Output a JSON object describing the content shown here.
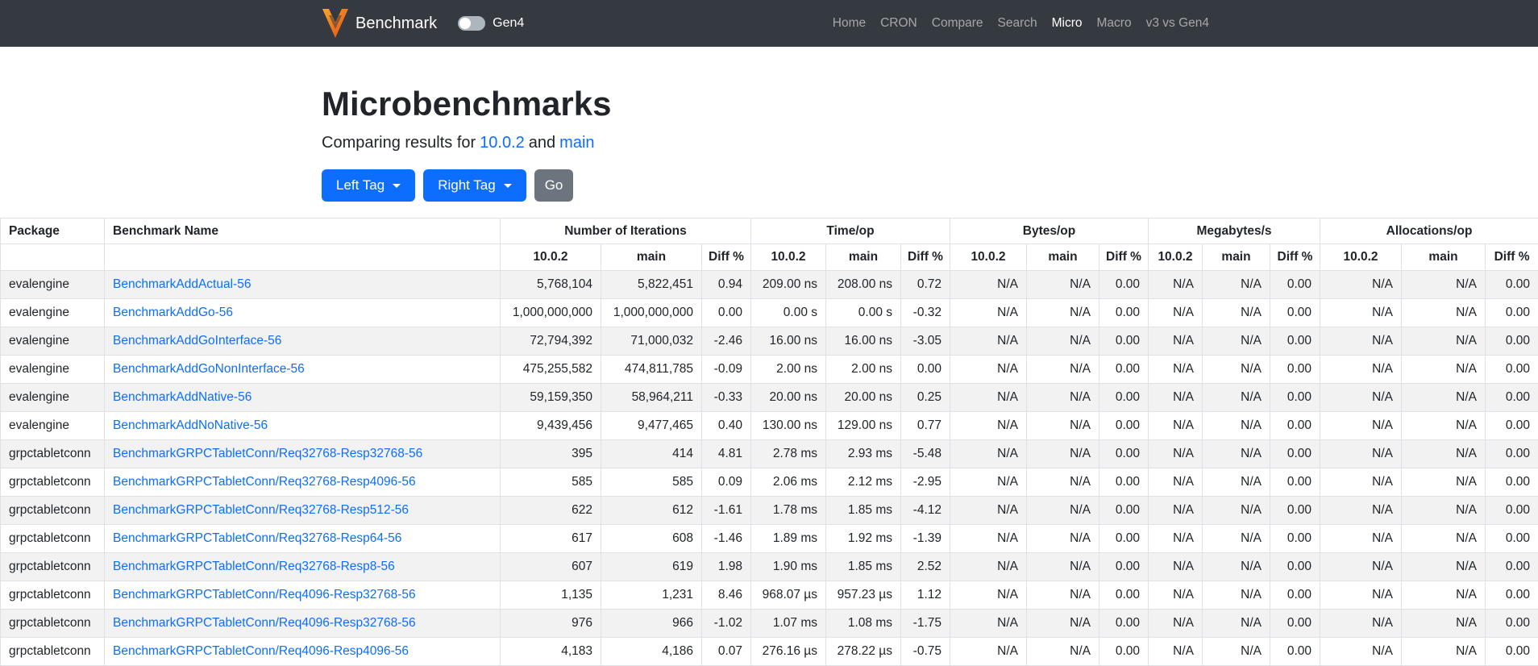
{
  "navbar": {
    "brand": "Benchmark",
    "toggle_label": "Gen4",
    "toggle_state": "off",
    "links": [
      {
        "label": "Home",
        "active": false
      },
      {
        "label": "CRON",
        "active": false
      },
      {
        "label": "Compare",
        "active": false
      },
      {
        "label": "Search",
        "active": false
      },
      {
        "label": "Micro",
        "active": true
      },
      {
        "label": "Macro",
        "active": false
      },
      {
        "label": "v3 vs Gen4",
        "active": false
      }
    ]
  },
  "header": {
    "title": "Microbenchmarks",
    "subtitle_prefix": "Comparing results for",
    "left_tag": "10.0.2",
    "and_word": "and",
    "right_tag": "main"
  },
  "controls": {
    "left_tag_button": "Left Tag",
    "right_tag_button": "Right Tag",
    "go_button": "Go"
  },
  "table": {
    "package_header": "Package",
    "benchmark_header": "Benchmark Name",
    "groups": [
      "Number of Iterations",
      "Time/op",
      "Bytes/op",
      "Megabytes/s",
      "Allocations/op"
    ],
    "sub_headers": [
      "10.0.2",
      "main",
      "Diff %"
    ],
    "rows": [
      {
        "package": "evalengine",
        "name": "BenchmarkAddActual-56",
        "iterations": [
          "5,768,104",
          "5,822,451",
          "0.94"
        ],
        "time": [
          "209.00 ns",
          "208.00 ns",
          "0.72"
        ],
        "bytes": [
          "N/A",
          "N/A",
          "0.00"
        ],
        "megabytes": [
          "N/A",
          "N/A",
          "0.00"
        ],
        "allocations": [
          "N/A",
          "N/A",
          "0.00"
        ]
      },
      {
        "package": "evalengine",
        "name": "BenchmarkAddGo-56",
        "iterations": [
          "1,000,000,000",
          "1,000,000,000",
          "0.00"
        ],
        "time": [
          "0.00 s",
          "0.00 s",
          "-0.32"
        ],
        "bytes": [
          "N/A",
          "N/A",
          "0.00"
        ],
        "megabytes": [
          "N/A",
          "N/A",
          "0.00"
        ],
        "allocations": [
          "N/A",
          "N/A",
          "0.00"
        ]
      },
      {
        "package": "evalengine",
        "name": "BenchmarkAddGoInterface-56",
        "iterations": [
          "72,794,392",
          "71,000,032",
          "-2.46"
        ],
        "time": [
          "16.00 ns",
          "16.00 ns",
          "-3.05"
        ],
        "bytes": [
          "N/A",
          "N/A",
          "0.00"
        ],
        "megabytes": [
          "N/A",
          "N/A",
          "0.00"
        ],
        "allocations": [
          "N/A",
          "N/A",
          "0.00"
        ]
      },
      {
        "package": "evalengine",
        "name": "BenchmarkAddGoNonInterface-56",
        "iterations": [
          "475,255,582",
          "474,811,785",
          "-0.09"
        ],
        "time": [
          "2.00 ns",
          "2.00 ns",
          "0.00"
        ],
        "bytes": [
          "N/A",
          "N/A",
          "0.00"
        ],
        "megabytes": [
          "N/A",
          "N/A",
          "0.00"
        ],
        "allocations": [
          "N/A",
          "N/A",
          "0.00"
        ]
      },
      {
        "package": "evalengine",
        "name": "BenchmarkAddNative-56",
        "iterations": [
          "59,159,350",
          "58,964,211",
          "-0.33"
        ],
        "time": [
          "20.00 ns",
          "20.00 ns",
          "0.25"
        ],
        "bytes": [
          "N/A",
          "N/A",
          "0.00"
        ],
        "megabytes": [
          "N/A",
          "N/A",
          "0.00"
        ],
        "allocations": [
          "N/A",
          "N/A",
          "0.00"
        ]
      },
      {
        "package": "evalengine",
        "name": "BenchmarkAddNoNative-56",
        "iterations": [
          "9,439,456",
          "9,477,465",
          "0.40"
        ],
        "time": [
          "130.00 ns",
          "129.00 ns",
          "0.77"
        ],
        "bytes": [
          "N/A",
          "N/A",
          "0.00"
        ],
        "megabytes": [
          "N/A",
          "N/A",
          "0.00"
        ],
        "allocations": [
          "N/A",
          "N/A",
          "0.00"
        ]
      },
      {
        "package": "grpctabletconn",
        "name": "BenchmarkGRPCTabletConn/Req32768-Resp32768-56",
        "iterations": [
          "395",
          "414",
          "4.81"
        ],
        "time": [
          "2.78 ms",
          "2.93 ms",
          "-5.48"
        ],
        "bytes": [
          "N/A",
          "N/A",
          "0.00"
        ],
        "megabytes": [
          "N/A",
          "N/A",
          "0.00"
        ],
        "allocations": [
          "N/A",
          "N/A",
          "0.00"
        ]
      },
      {
        "package": "grpctabletconn",
        "name": "BenchmarkGRPCTabletConn/Req32768-Resp4096-56",
        "iterations": [
          "585",
          "585",
          "0.09"
        ],
        "time": [
          "2.06 ms",
          "2.12 ms",
          "-2.95"
        ],
        "bytes": [
          "N/A",
          "N/A",
          "0.00"
        ],
        "megabytes": [
          "N/A",
          "N/A",
          "0.00"
        ],
        "allocations": [
          "N/A",
          "N/A",
          "0.00"
        ]
      },
      {
        "package": "grpctabletconn",
        "name": "BenchmarkGRPCTabletConn/Req32768-Resp512-56",
        "iterations": [
          "622",
          "612",
          "-1.61"
        ],
        "time": [
          "1.78 ms",
          "1.85 ms",
          "-4.12"
        ],
        "bytes": [
          "N/A",
          "N/A",
          "0.00"
        ],
        "megabytes": [
          "N/A",
          "N/A",
          "0.00"
        ],
        "allocations": [
          "N/A",
          "N/A",
          "0.00"
        ]
      },
      {
        "package": "grpctabletconn",
        "name": "BenchmarkGRPCTabletConn/Req32768-Resp64-56",
        "iterations": [
          "617",
          "608",
          "-1.46"
        ],
        "time": [
          "1.89 ms",
          "1.92 ms",
          "-1.39"
        ],
        "bytes": [
          "N/A",
          "N/A",
          "0.00"
        ],
        "megabytes": [
          "N/A",
          "N/A",
          "0.00"
        ],
        "allocations": [
          "N/A",
          "N/A",
          "0.00"
        ]
      },
      {
        "package": "grpctabletconn",
        "name": "BenchmarkGRPCTabletConn/Req32768-Resp8-56",
        "iterations": [
          "607",
          "619",
          "1.98"
        ],
        "time": [
          "1.90 ms",
          "1.85 ms",
          "2.52"
        ],
        "bytes": [
          "N/A",
          "N/A",
          "0.00"
        ],
        "megabytes": [
          "N/A",
          "N/A",
          "0.00"
        ],
        "allocations": [
          "N/A",
          "N/A",
          "0.00"
        ]
      },
      {
        "package": "grpctabletconn",
        "name": "BenchmarkGRPCTabletConn/Req4096-Resp32768-56",
        "iterations": [
          "1,135",
          "1,231",
          "8.46"
        ],
        "time": [
          "968.07 µs",
          "957.23 µs",
          "1.12"
        ],
        "bytes": [
          "N/A",
          "N/A",
          "0.00"
        ],
        "megabytes": [
          "N/A",
          "N/A",
          "0.00"
        ],
        "allocations": [
          "N/A",
          "N/A",
          "0.00"
        ]
      },
      {
        "package": "grpctabletconn",
        "name": "BenchmarkGRPCTabletConn/Req4096-Resp32768-56",
        "iterations": [
          "976",
          "966",
          "-1.02"
        ],
        "time": [
          "1.07 ms",
          "1.08 ms",
          "-1.75"
        ],
        "bytes": [
          "N/A",
          "N/A",
          "0.00"
        ],
        "megabytes": [
          "N/A",
          "N/A",
          "0.00"
        ],
        "allocations": [
          "N/A",
          "N/A",
          "0.00"
        ]
      },
      {
        "package": "grpctabletconn",
        "name": "BenchmarkGRPCTabletConn/Req4096-Resp4096-56",
        "iterations": [
          "4,183",
          "4,186",
          "0.07"
        ],
        "time": [
          "276.16 µs",
          "278.22 µs",
          "-0.75"
        ],
        "bytes": [
          "N/A",
          "N/A",
          "0.00"
        ],
        "megabytes": [
          "N/A",
          "N/A",
          "0.00"
        ],
        "allocations": [
          "N/A",
          "N/A",
          "0.00"
        ]
      }
    ]
  },
  "colors": {
    "navbar_bg": "#343a40",
    "nav_link": "#9aa0a6",
    "nav_link_active": "#ffffff",
    "accent_blue": "#0d6efd",
    "go_gray": "#6c757d",
    "logo_orange_light": "#f9a825",
    "logo_orange_dark": "#e64a19",
    "table_border": "#dee2e6",
    "row_stripe": "#f2f2f2",
    "text": "#212529"
  }
}
